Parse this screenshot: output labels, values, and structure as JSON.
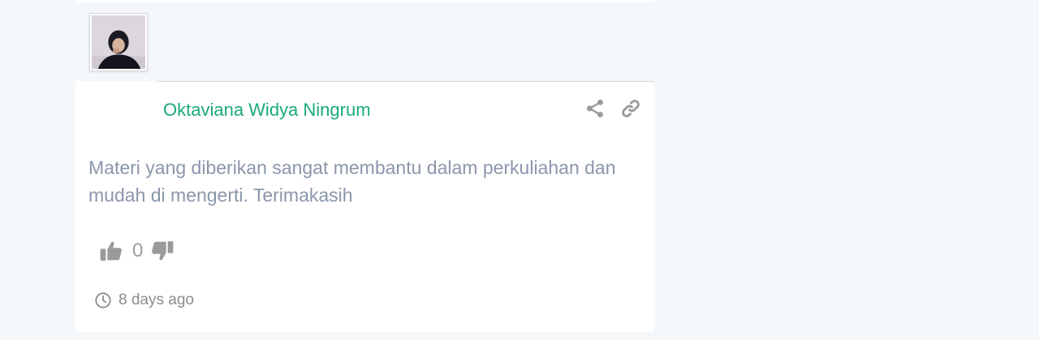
{
  "comment": {
    "author_name": "Oktaviana Widya Ningrum",
    "text": "Materi yang diberikan sangat membantu dalam perkuliahan dan mudah di mengerti. Terimakasih",
    "vote_count": "0",
    "timestamp": "8 days ago"
  },
  "icons": {
    "share": "share-icon",
    "link": "link-icon",
    "upvote": "thumbs-up-icon",
    "downvote": "thumbs-down-icon",
    "clock": "clock-icon"
  },
  "colors": {
    "author": "#1aa97a",
    "body_text": "#8a96ab",
    "icon_gray": "#9a9a9a",
    "page_bg": "#f4f8fb"
  }
}
